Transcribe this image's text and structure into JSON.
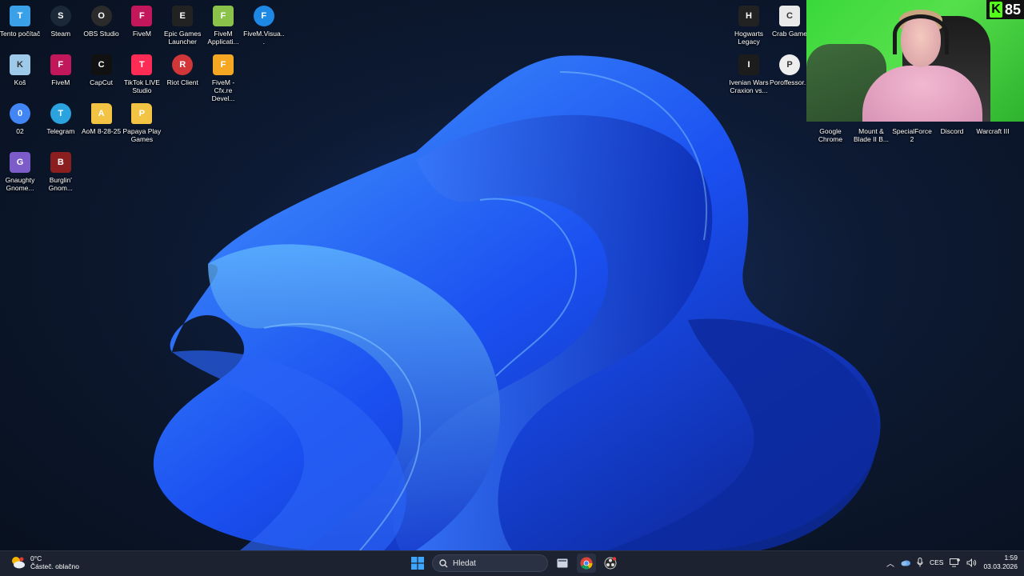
{
  "desktop": {
    "left_icons": [
      {
        "label": "Tento počítač",
        "icon": "computer-icon",
        "color": "#3aa0e8"
      },
      {
        "label": "Steam",
        "icon": "steam-icon",
        "color": "#1b2838"
      },
      {
        "label": "OBS Studio",
        "icon": "obs-icon",
        "color": "#2b2b2b"
      },
      {
        "label": "FiveM",
        "icon": "fivem-icon",
        "color": "#c2185b"
      },
      {
        "label": "Epic Games Launcher",
        "icon": "epic-games-icon",
        "color": "#222222"
      },
      {
        "label": "FiveM Applicati...",
        "icon": "fivem-app-icon",
        "color": "#8bc34a"
      },
      {
        "label": "FiveM.Visua...",
        "icon": "edge-icon",
        "color": "#1e88e5"
      },
      {
        "label": "Koš",
        "icon": "recycle-bin-icon",
        "color": "#9ec9e8"
      },
      {
        "label": "FiveM",
        "icon": "fivem-icon",
        "color": "#c2185b"
      },
      {
        "label": "CapCut",
        "icon": "capcut-icon",
        "color": "#111111"
      },
      {
        "label": "TikTok LIVE Studio",
        "icon": "tiktok-icon",
        "color": "#fe2c55"
      },
      {
        "label": "Riot Client",
        "icon": "riot-icon",
        "color": "#d13639"
      },
      {
        "label": "FiveM - Cfx.re Devel...",
        "icon": "cfx-icon",
        "color": "#f5a623"
      },
      {
        "label": "02",
        "icon": "chrome-icon",
        "color": "#4285f4"
      },
      {
        "label": "Telegram",
        "icon": "telegram-icon",
        "color": "#2aa3df"
      },
      {
        "label": "AoM 8-28-25",
        "icon": "folder-icon",
        "color": "#f3c443"
      },
      {
        "label": "Papaya Play Games",
        "icon": "folder-icon",
        "color": "#f3c443"
      },
      {
        "label": "Gnaughty Gnome...",
        "icon": "gnome-game-icon",
        "color": "#7b5cc9"
      },
      {
        "label": "Burglin' Gnom...",
        "icon": "burglin-gnomes-icon",
        "color": "#8b1e1e"
      }
    ],
    "right_icons": [
      {
        "label": "Hogwarts Legacy",
        "icon": "hogwarts-icon",
        "color": "#222222"
      },
      {
        "label": "Crab Game",
        "icon": "crab-game-icon",
        "color": "#e9e9e9"
      },
      {
        "label": "Ivenian Wars Craxion vs...",
        "icon": "ivenian-wars-icon",
        "color": "#1c1c1c"
      },
      {
        "label": "Poroffessor...",
        "icon": "poroffessor-icon",
        "color": "#eeeeee"
      },
      {
        "label": "Google Chrome",
        "icon": "chrome-icon",
        "color": "#4285f4"
      },
      {
        "label": "Mount & Blade II B...",
        "icon": "bannerlord-icon",
        "color": "#6b4a2b"
      },
      {
        "label": "SpecialForce2",
        "icon": "specialforce-icon",
        "color": "#3b3b3b"
      },
      {
        "label": "Discord",
        "icon": "discord-icon",
        "color": "#5865f2"
      },
      {
        "label": "Warcraft III",
        "icon": "warcraft-icon",
        "color": "#1e4b8f"
      }
    ]
  },
  "webcam": {
    "badge_letter": "K",
    "badge_number": "85"
  },
  "taskbar": {
    "weather_temp": "0°C",
    "weather_desc": "Částeč. oblačno",
    "search_placeholder": "Hledat",
    "language": "CES",
    "time": "1:59",
    "date": "03.03.2026"
  }
}
